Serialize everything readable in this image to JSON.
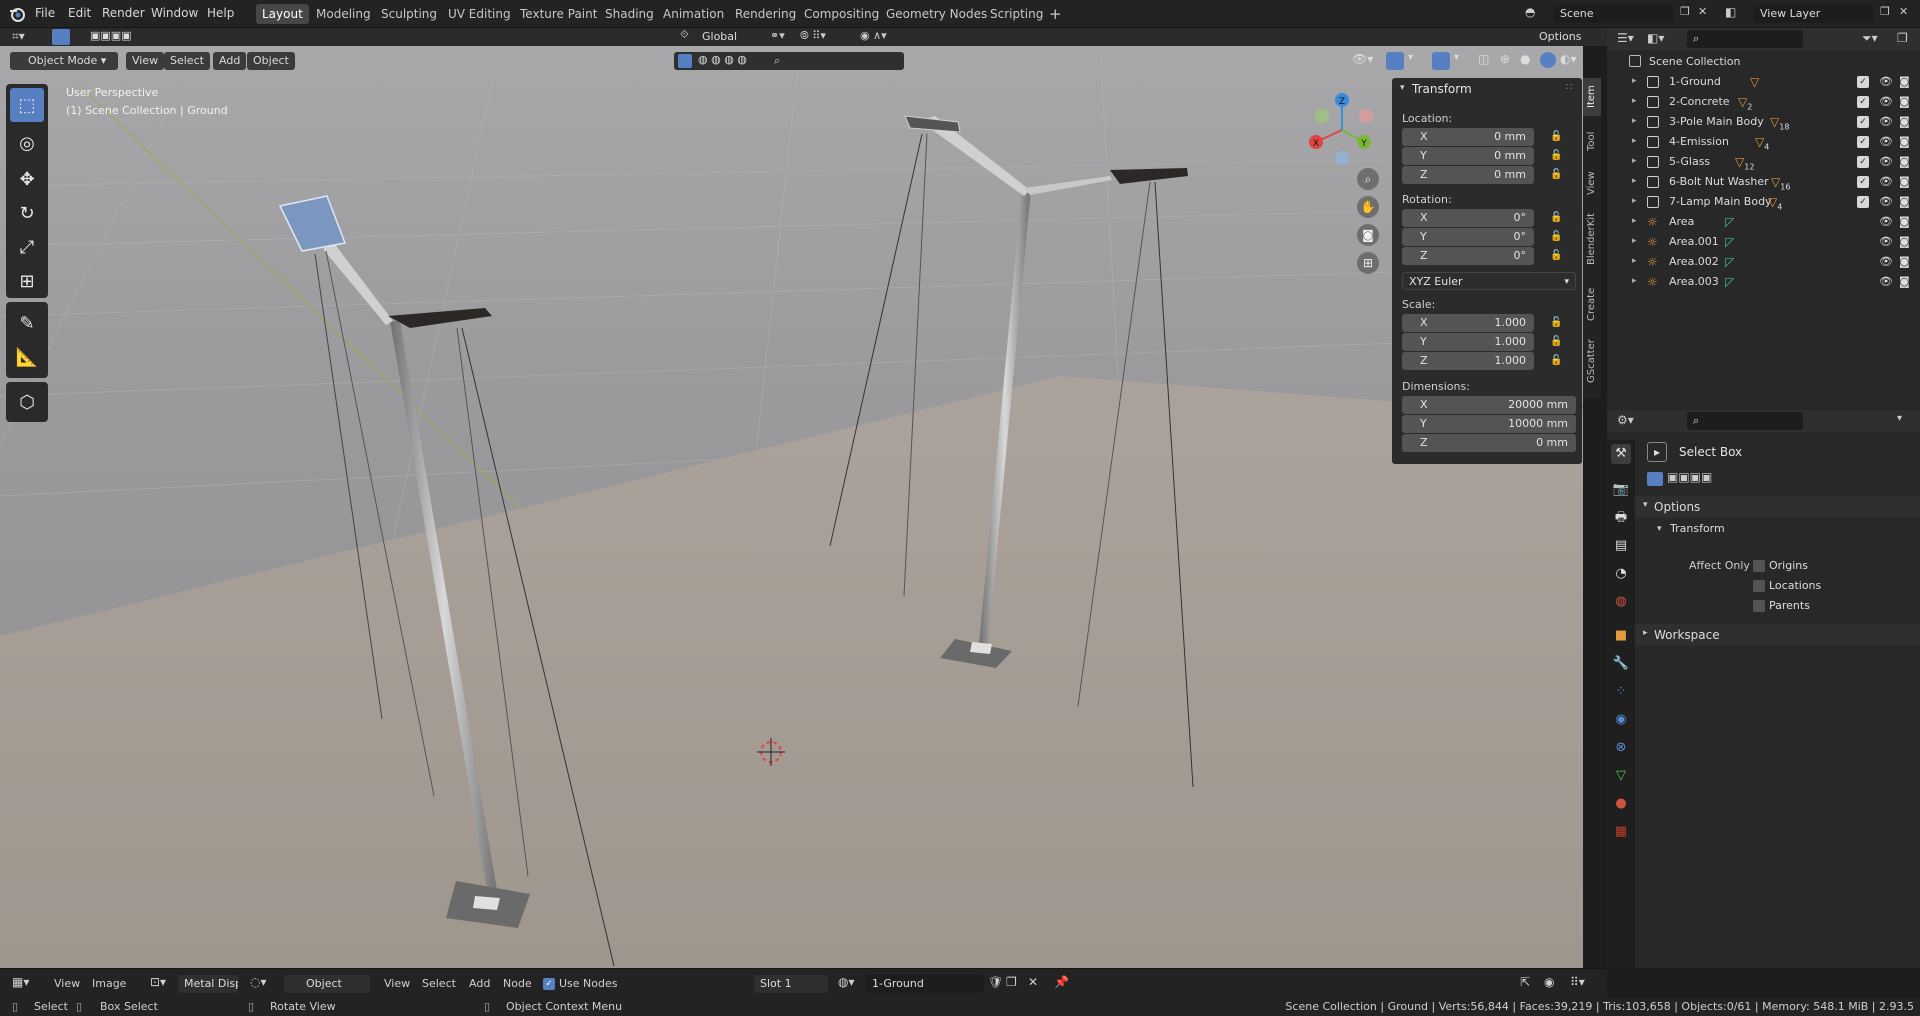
{
  "menu": {
    "file": "File",
    "edit": "Edit",
    "render": "Render",
    "window": "Window",
    "help": "Help"
  },
  "workspaces": [
    "Layout",
    "Modeling",
    "Sculpting",
    "UV Editing",
    "Texture Paint",
    "Shading",
    "Animation",
    "Rendering",
    "Compositing",
    "Geometry Nodes",
    "Scripting"
  ],
  "active_workspace": "Layout",
  "scene": "Scene",
  "view_layer": "View Layer",
  "viewport_header": {
    "mode": "Object Mode",
    "view": "View",
    "select": "Select",
    "add": "Add",
    "object": "Object",
    "orientation": "Global",
    "options": "Options"
  },
  "overlay": {
    "perspective": "User Perspective",
    "collection": "(1) Scene Collection | Ground"
  },
  "gizmo": {
    "x": "X",
    "y": "Y",
    "z": "Z"
  },
  "npanel": {
    "title": "Transform",
    "location_label": "Location:",
    "location": [
      {
        "axis": "X",
        "value": "0 mm"
      },
      {
        "axis": "Y",
        "value": "0 mm"
      },
      {
        "axis": "Z",
        "value": "0 mm"
      }
    ],
    "rotation_label": "Rotation:",
    "rotation": [
      {
        "axis": "X",
        "value": "0°"
      },
      {
        "axis": "Y",
        "value": "0°"
      },
      {
        "axis": "Z",
        "value": "0°"
      }
    ],
    "rotation_mode": "XYZ Euler",
    "scale_label": "Scale:",
    "scale": [
      {
        "axis": "X",
        "value": "1.000"
      },
      {
        "axis": "Y",
        "value": "1.000"
      },
      {
        "axis": "Z",
        "value": "1.000"
      }
    ],
    "dimensions_label": "Dimensions:",
    "dimensions": [
      {
        "axis": "X",
        "value": "20000 mm"
      },
      {
        "axis": "Y",
        "value": "10000 mm"
      },
      {
        "axis": "Z",
        "value": "0 mm"
      }
    ]
  },
  "side_tabs": [
    "Item",
    "Tool",
    "View",
    "BlenderKit",
    "Create",
    "GScatter"
  ],
  "outliner": {
    "root": "Scene Collection",
    "items": [
      {
        "name": "1-Ground",
        "badge": ""
      },
      {
        "name": "2-Concrete",
        "badge": "2"
      },
      {
        "name": "3-Pole Main Body",
        "badge": "18"
      },
      {
        "name": "4-Emission",
        "badge": "4"
      },
      {
        "name": "5-Glass",
        "badge": "12"
      },
      {
        "name": "6-Bolt Nut Washer",
        "badge": "16"
      },
      {
        "name": "7-Lamp Main Body",
        "badge": "4"
      },
      {
        "name": "Area",
        "badge": ""
      },
      {
        "name": "Area.001",
        "badge": ""
      },
      {
        "name": "Area.002",
        "badge": ""
      },
      {
        "name": "Area.003",
        "badge": ""
      }
    ]
  },
  "properties": {
    "tool_name": "Select Box",
    "options": "Options",
    "transform": "Transform",
    "affect_only": "Affect Only",
    "origins": "Origins",
    "locations": "Locations",
    "parents": "Parents",
    "workspace": "Workspace"
  },
  "bottom": {
    "view": "View",
    "image": "Image",
    "metal": "Metal Disp",
    "object": "Object",
    "view2": "View",
    "select": "Select",
    "add": "Add",
    "node": "Node",
    "use_nodes": "Use Nodes",
    "slot": "Slot 1",
    "material": "1-Ground"
  },
  "status": {
    "select": "Select",
    "box_select": "Box Select",
    "rotate_view": "Rotate View",
    "context_menu": "Object Context Menu",
    "stats": "Scene Collection | Ground | Verts:56,844 | Faces:39,219 | Tris:103,658 | Objects:0/61 | Memory: 548.1 MiB | 2.93.5"
  },
  "colors": {
    "accent": "#5680c2",
    "object_orange": "#e39a3a",
    "x_axis": "#e04545",
    "y_axis": "#7ab83a",
    "z_axis": "#3a8ae0"
  }
}
